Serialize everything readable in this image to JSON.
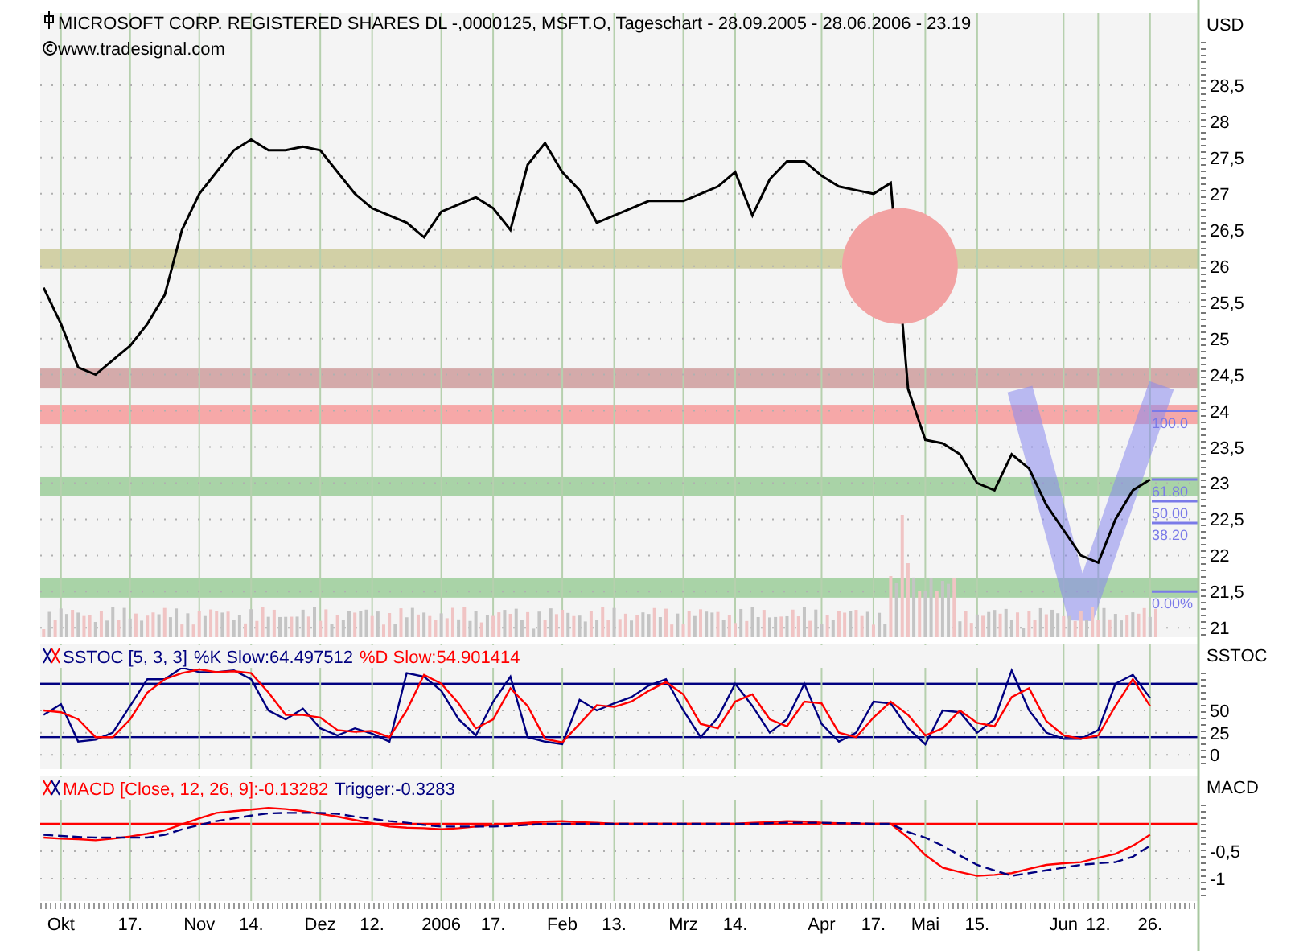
{
  "chart": {
    "title": "MICROSOFT CORP. REGISTERED SHARES DL -,0000125, MSFT.O, Tageschart - 28.09.2005 - 28.06.2006 - 23.19",
    "source": "www.tradesignal.com"
  },
  "price_panel": {
    "chart_data": {
      "type": "line",
      "ylabel": "USD",
      "grid": true,
      "ylim": [
        20.87,
        29.5
      ],
      "yticks": [
        {
          "value": 21,
          "label": "21"
        },
        {
          "value": 21.5,
          "label": "21,5"
        },
        {
          "value": 22,
          "label": "22"
        },
        {
          "value": 22.5,
          "label": "22,5"
        },
        {
          "value": 23,
          "label": "23"
        },
        {
          "value": 23.5,
          "label": "23,5"
        },
        {
          "value": 24,
          "label": "24"
        },
        {
          "value": 24.5,
          "label": "24,5"
        },
        {
          "value": 25,
          "label": "25"
        },
        {
          "value": 25.5,
          "label": "25,5"
        },
        {
          "value": 26,
          "label": "26"
        },
        {
          "value": 26.5,
          "label": "26,5"
        },
        {
          "value": 27,
          "label": "27"
        },
        {
          "value": 27.5,
          "label": "27,5"
        },
        {
          "value": 28,
          "label": "28"
        },
        {
          "value": 28.5,
          "label": "28,5"
        }
      ],
      "series": [
        {
          "color": "#000000",
          "values": [
            25.7,
            25.2,
            24.6,
            24.5,
            24.7,
            24.9,
            25.2,
            25.6,
            26.5,
            27.0,
            27.3,
            27.6,
            27.75,
            27.6,
            27.6,
            27.65,
            27.6,
            27.3,
            27.0,
            26.8,
            26.7,
            26.6,
            26.4,
            26.75,
            26.85,
            26.95,
            26.8,
            26.5,
            27.4,
            27.7,
            27.3,
            27.05,
            26.6,
            26.7,
            26.8,
            26.9,
            26.9,
            26.9,
            27.0,
            27.1,
            27.3,
            26.7,
            27.2,
            27.45,
            27.45,
            27.25,
            27.1,
            27.05,
            27.0,
            27.15,
            24.3,
            23.6,
            23.55,
            23.4,
            23.0,
            22.9,
            23.4,
            23.2,
            22.7,
            22.35,
            22.0,
            21.9,
            22.5,
            22.9,
            23.05
          ]
        }
      ]
    },
    "bands": [
      {
        "color": "#d2d0a6"
      },
      {
        "color": "#d4aaaa"
      },
      {
        "color": "#f6a8a8"
      },
      {
        "color": "#a9d3a7"
      },
      {
        "color": "#a9d3a7"
      }
    ],
    "marker_circle": {
      "color": "#f2a2a2"
    },
    "v_pattern": {
      "color": "#8888ee"
    },
    "fib_levels": [
      {
        "label": "100.0"
      },
      {
        "label": "61.80"
      },
      {
        "label": "50.00"
      },
      {
        "label": "38.20"
      },
      {
        "label": "0.00%"
      }
    ]
  },
  "sstoc_panel": {
    "level_lines": [
      {
        "color": "#000080"
      },
      {
        "color": "#000080"
      }
    ],
    "title": "SSTOC [5, 3, 3]",
    "readings": [
      ":64.497512",
      ":54.901414"
    ],
    "chart_data": {
      "type": "line",
      "ylabel": "SSTOC",
      "grid": true,
      "ylim": [
        -16,
        125
      ],
      "yticks": [
        0,
        25,
        50
      ],
      "series": [
        {
          "name": "%K Slow",
          "color": "#000080",
          "values": [
            45,
            57,
            15,
            17,
            25,
            55,
            85,
            85,
            98,
            93,
            93,
            95,
            85,
            50,
            40,
            52,
            30,
            22,
            30,
            24,
            15,
            92,
            88,
            72,
            40,
            22,
            60,
            88,
            20,
            15,
            12,
            62,
            50,
            58,
            65,
            78,
            85,
            50,
            20,
            42,
            80,
            55,
            25,
            40,
            80,
            35,
            15,
            25,
            60,
            58,
            30,
            12,
            50,
            48,
            25,
            40,
            95,
            50,
            25,
            18,
            18,
            28,
            80,
            90,
            64
          ]
        },
        {
          "name": "%D Slow",
          "color": "#ff0000",
          "values": [
            50,
            48,
            40,
            20,
            20,
            40,
            70,
            85,
            92,
            96,
            93,
            94,
            92,
            70,
            45,
            45,
            42,
            28,
            26,
            27,
            20,
            50,
            90,
            80,
            58,
            30,
            40,
            75,
            55,
            18,
            14,
            35,
            56,
            54,
            60,
            72,
            82,
            68,
            35,
            30,
            60,
            68,
            40,
            32,
            60,
            58,
            25,
            20,
            42,
            60,
            45,
            22,
            30,
            50,
            36,
            32,
            65,
            75,
            38,
            22,
            18,
            22,
            55,
            85,
            55
          ]
        }
      ]
    }
  },
  "macd_panel": {
    "level_lines": [
      {
        "color": "#ff0000"
      }
    ],
    "readings": [
      ":-0.13282",
      ":-0.3283"
    ],
    "chart_data": {
      "type": "line",
      "ylabel": "MACD",
      "grid": true,
      "ylim": [
        -1.41,
        0.88
      ],
      "yticks": [
        {
          "value": -0.5,
          "label": "-0,5"
        },
        {
          "value": -1,
          "label": "-1"
        }
      ],
      "categories": [
        null,
        "Okt",
        null,
        null,
        null,
        "17.",
        null,
        null,
        null,
        "Nov",
        null,
        null,
        "14.",
        null,
        null,
        null,
        "Dez",
        null,
        null,
        "12.",
        null,
        null,
        null,
        "2006",
        null,
        null,
        "17.",
        null,
        null,
        null,
        "Feb",
        null,
        null,
        "13.",
        null,
        null,
        null,
        "Mrz",
        null,
        null,
        "14.",
        null,
        null,
        null,
        null,
        "Apr",
        null,
        null,
        "17.",
        null,
        null,
        "Mai",
        null,
        null,
        "15.",
        null,
        null,
        null,
        null,
        "Jun",
        null,
        "12.",
        null,
        null,
        "26."
      ],
      "series": [
        {
          "name": "MACD [Close, 12, 26, 9]",
          "color": "#ff0000",
          "values": [
            -0.25,
            -0.27,
            -0.28,
            -0.3,
            -0.27,
            -0.23,
            -0.18,
            -0.12,
            -0.01,
            0.1,
            0.2,
            0.23,
            0.26,
            0.29,
            0.27,
            0.23,
            0.18,
            0.13,
            0.07,
            0.01,
            -0.05,
            -0.07,
            -0.08,
            -0.1,
            -0.08,
            -0.05,
            -0.02,
            0,
            0.02,
            0.04,
            0.05,
            0.03,
            0.02,
            0,
            0,
            0,
            0,
            0,
            0,
            0,
            0,
            0.02,
            0.03,
            0.05,
            0.04,
            0.02,
            0.01,
            0,
            0,
            0,
            -0.25,
            -0.57,
            -0.8,
            -0.88,
            -0.95,
            -0.93,
            -0.9,
            -0.82,
            -0.75,
            -0.72,
            -0.7,
            -0.62,
            -0.55,
            -0.4,
            -0.2
          ]
        },
        {
          "name": "Trigger",
          "color": "#000080",
          "line_style": "dashed",
          "values": [
            -0.2,
            -0.22,
            -0.24,
            -0.25,
            -0.25,
            -0.25,
            -0.25,
            -0.2,
            -0.1,
            -0.02,
            0.05,
            0.1,
            0.15,
            0.19,
            0.2,
            0.2,
            0.2,
            0.18,
            0.13,
            0.09,
            0.05,
            0.02,
            -0.02,
            -0.05,
            -0.05,
            -0.05,
            -0.05,
            -0.04,
            -0.02,
            0,
            0,
            0,
            0,
            0,
            0,
            0,
            0,
            0,
            0,
            0,
            0,
            0,
            0.01,
            0.02,
            0.02,
            0.02,
            0.01,
            0.01,
            0,
            0,
            -0.15,
            -0.25,
            -0.4,
            -0.58,
            -0.75,
            -0.85,
            -0.95,
            -0.9,
            -0.85,
            -0.8,
            -0.75,
            -0.72,
            -0.7,
            -0.6,
            -0.4
          ]
        }
      ]
    }
  }
}
